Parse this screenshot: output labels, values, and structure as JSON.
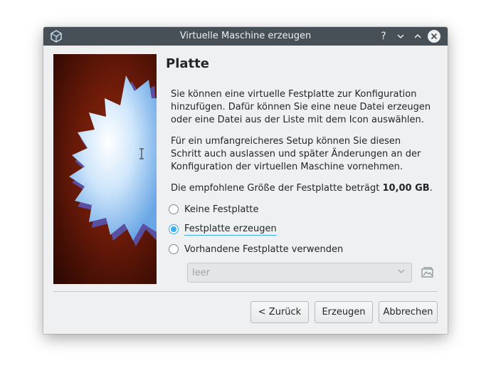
{
  "window": {
    "title": "Virtuelle Maschine erzeugen",
    "controls": {
      "help": "?",
      "minimize": "⌄",
      "maximize": "⌃",
      "close": "✕"
    }
  },
  "page": {
    "heading": "Platte",
    "paragraph1": "Sie können eine virtuelle Festplatte zur Konfiguration hinzufügen. Dafür können Sie eine neue Datei erzeugen oder eine Datei aus der Liste mit dem Icon auswählen.",
    "paragraph2": "Für ein umfangreicheres Setup können Sie diesen Schritt auch auslassen und später Änderungen an der Konfiguration der virtuellen Maschine vornehmen.",
    "recommended_prefix": "Die empfohlene Größe der Festplatte beträgt ",
    "recommended_size": "10,00 GB",
    "recommended_suffix": "."
  },
  "options": [
    {
      "label": "Keine Festplatte",
      "checked": false
    },
    {
      "label": "Festplatte erzeugen",
      "checked": true
    },
    {
      "label": "Vorhandene Festplatte verwenden",
      "checked": false
    }
  ],
  "disk_select": {
    "value": "leer",
    "enabled": false
  },
  "buttons": {
    "back": "< Zurück",
    "create": "Erzeugen",
    "cancel": "Abbrechen"
  },
  "colors": {
    "titlebar": "#475057",
    "accent": "#3daee9",
    "dialog_bg": "#eff0f1"
  },
  "icons": {
    "app": "virtualbox-icon",
    "file": "folder-image-icon",
    "combo": "chevron-down-icon"
  }
}
